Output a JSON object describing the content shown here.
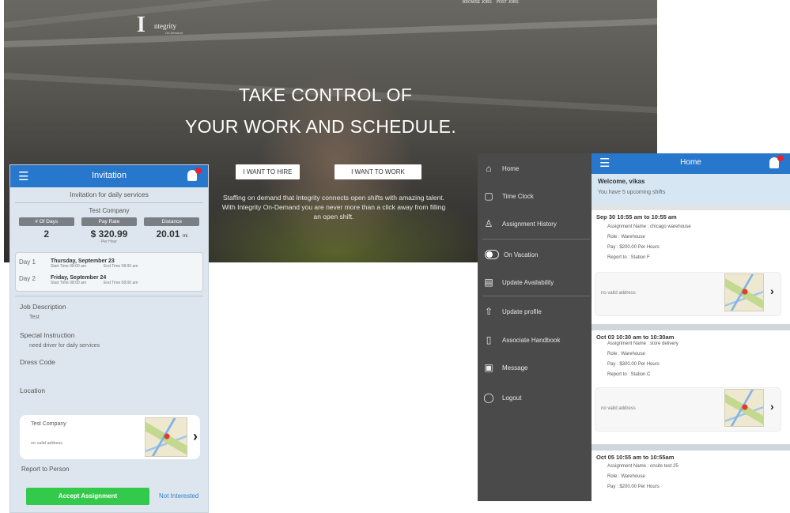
{
  "hero": {
    "logo_mark": "I",
    "logo_text": "ntegrity",
    "logo_sub": "On-Demand",
    "top_links": [
      "BROWSE JOBS",
      "POST JOBS"
    ],
    "headline_1": "TAKE CONTROL OF",
    "headline_2": "YOUR WORK AND SCHEDULE.",
    "btn_hire": "I WANT TO HIRE",
    "btn_work": "I WANT TO WORK",
    "blurb": "Staffing on demand that Integrity connects open shifts with amazing talent. With Integrity On-Demand you are never more than a click away from filling an open shift."
  },
  "invitation": {
    "title": "Invitation",
    "message": "Invitation for daily services",
    "company": "Test Company",
    "stats": [
      {
        "label": "# Of Days",
        "value": "2",
        "sub": ""
      },
      {
        "label": "Pay Rate",
        "value": "$ 320.99",
        "sub": "Per Hour"
      },
      {
        "label": "Distance",
        "value": "20.01",
        "sub": "mi"
      }
    ],
    "days": [
      {
        "label": "Day 1",
        "date": "Thursday, September 23",
        "start": "Start Time 08:00 am",
        "end": "End Time 08:00 am"
      },
      {
        "label": "Day 2",
        "date": "Friday, September 24",
        "start": "Start Time 08:00 am",
        "end": "End Time 08:00 am"
      }
    ],
    "job_desc_label": "Job Description",
    "job_desc_value": "Test",
    "special_label": "Special Instruction",
    "special_value": "need driver for daily services",
    "dress_label": "Dress Code",
    "location_label": "Location",
    "location_name": "Test Company",
    "location_addr": "no valid address",
    "report_label": "Report to Person",
    "accept_label": "Accept Assignment",
    "not_interested_label": "Not Interested"
  },
  "sidebar": {
    "items": [
      {
        "icon": "home-icon",
        "label": "Home"
      },
      {
        "icon": "time-clock-icon",
        "label": "Time Clock"
      },
      {
        "icon": "person-icon",
        "label": "Assignment History"
      },
      {
        "icon": "toggle-icon",
        "label": "On Vacation"
      },
      {
        "icon": "calendar-icon",
        "label": "Update Availability"
      },
      {
        "icon": "upload-icon",
        "label": "Update profile"
      },
      {
        "icon": "book-icon",
        "label": "Associate Handbook"
      },
      {
        "icon": "message-icon",
        "label": "Message"
      },
      {
        "icon": "logout-icon",
        "label": "Logout"
      }
    ]
  },
  "home": {
    "title": "Home",
    "welcome": "Welcome, vikas",
    "upcoming": "You have 5 upcoming shifts",
    "shifts": [
      {
        "time": "Sep 30 10:55 am to 10:55 am",
        "assignment": "Assignment Name : chicago warehouse",
        "role": "Role : Warehouse",
        "pay": "Pay : $200.00 Per Hours",
        "report": "Report to : Station F",
        "address": "no valid address"
      },
      {
        "time": "Oct 03 10:30 am to 10:30am",
        "assignment": "Assignment Name : store delivery",
        "role": "Role : Warehouse",
        "pay": "Pay : $300.00 Per Hours",
        "report": "Report to : Station C",
        "address": "no valid address"
      },
      {
        "time": "Oct 05 10:55 am to 10:55am",
        "assignment": "Assignment Name : onsite test 25",
        "role": "Role : Warehouse",
        "pay": "Pay : $200.00 Per Hours"
      }
    ]
  }
}
